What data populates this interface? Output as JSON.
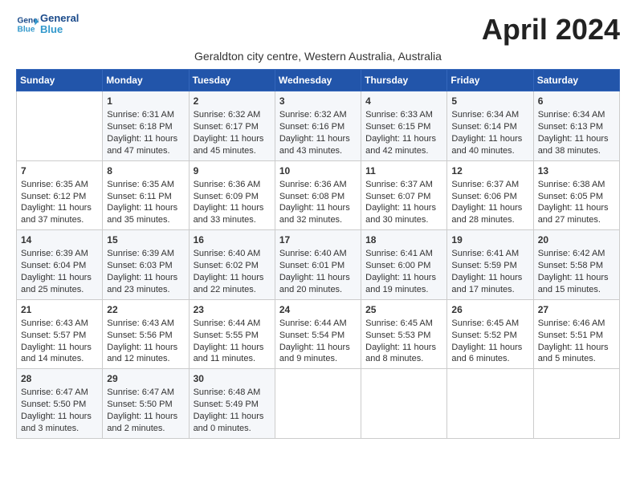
{
  "header": {
    "logo_line1": "General",
    "logo_line2": "Blue",
    "month_title": "April 2024",
    "subtitle": "Geraldton city centre, Western Australia, Australia"
  },
  "days_of_week": [
    "Sunday",
    "Monday",
    "Tuesday",
    "Wednesday",
    "Thursday",
    "Friday",
    "Saturday"
  ],
  "weeks": [
    [
      {
        "day": "",
        "content": ""
      },
      {
        "day": "1",
        "content": "Sunrise: 6:31 AM\nSunset: 6:18 PM\nDaylight: 11 hours\nand 47 minutes."
      },
      {
        "day": "2",
        "content": "Sunrise: 6:32 AM\nSunset: 6:17 PM\nDaylight: 11 hours\nand 45 minutes."
      },
      {
        "day": "3",
        "content": "Sunrise: 6:32 AM\nSunset: 6:16 PM\nDaylight: 11 hours\nand 43 minutes."
      },
      {
        "day": "4",
        "content": "Sunrise: 6:33 AM\nSunset: 6:15 PM\nDaylight: 11 hours\nand 42 minutes."
      },
      {
        "day": "5",
        "content": "Sunrise: 6:34 AM\nSunset: 6:14 PM\nDaylight: 11 hours\nand 40 minutes."
      },
      {
        "day": "6",
        "content": "Sunrise: 6:34 AM\nSunset: 6:13 PM\nDaylight: 11 hours\nand 38 minutes."
      }
    ],
    [
      {
        "day": "7",
        "content": "Sunrise: 6:35 AM\nSunset: 6:12 PM\nDaylight: 11 hours\nand 37 minutes."
      },
      {
        "day": "8",
        "content": "Sunrise: 6:35 AM\nSunset: 6:11 PM\nDaylight: 11 hours\nand 35 minutes."
      },
      {
        "day": "9",
        "content": "Sunrise: 6:36 AM\nSunset: 6:09 PM\nDaylight: 11 hours\nand 33 minutes."
      },
      {
        "day": "10",
        "content": "Sunrise: 6:36 AM\nSunset: 6:08 PM\nDaylight: 11 hours\nand 32 minutes."
      },
      {
        "day": "11",
        "content": "Sunrise: 6:37 AM\nSunset: 6:07 PM\nDaylight: 11 hours\nand 30 minutes."
      },
      {
        "day": "12",
        "content": "Sunrise: 6:37 AM\nSunset: 6:06 PM\nDaylight: 11 hours\nand 28 minutes."
      },
      {
        "day": "13",
        "content": "Sunrise: 6:38 AM\nSunset: 6:05 PM\nDaylight: 11 hours\nand 27 minutes."
      }
    ],
    [
      {
        "day": "14",
        "content": "Sunrise: 6:39 AM\nSunset: 6:04 PM\nDaylight: 11 hours\nand 25 minutes."
      },
      {
        "day": "15",
        "content": "Sunrise: 6:39 AM\nSunset: 6:03 PM\nDaylight: 11 hours\nand 23 minutes."
      },
      {
        "day": "16",
        "content": "Sunrise: 6:40 AM\nSunset: 6:02 PM\nDaylight: 11 hours\nand 22 minutes."
      },
      {
        "day": "17",
        "content": "Sunrise: 6:40 AM\nSunset: 6:01 PM\nDaylight: 11 hours\nand 20 minutes."
      },
      {
        "day": "18",
        "content": "Sunrise: 6:41 AM\nSunset: 6:00 PM\nDaylight: 11 hours\nand 19 minutes."
      },
      {
        "day": "19",
        "content": "Sunrise: 6:41 AM\nSunset: 5:59 PM\nDaylight: 11 hours\nand 17 minutes."
      },
      {
        "day": "20",
        "content": "Sunrise: 6:42 AM\nSunset: 5:58 PM\nDaylight: 11 hours\nand 15 minutes."
      }
    ],
    [
      {
        "day": "21",
        "content": "Sunrise: 6:43 AM\nSunset: 5:57 PM\nDaylight: 11 hours\nand 14 minutes."
      },
      {
        "day": "22",
        "content": "Sunrise: 6:43 AM\nSunset: 5:56 PM\nDaylight: 11 hours\nand 12 minutes."
      },
      {
        "day": "23",
        "content": "Sunrise: 6:44 AM\nSunset: 5:55 PM\nDaylight: 11 hours\nand 11 minutes."
      },
      {
        "day": "24",
        "content": "Sunrise: 6:44 AM\nSunset: 5:54 PM\nDaylight: 11 hours\nand 9 minutes."
      },
      {
        "day": "25",
        "content": "Sunrise: 6:45 AM\nSunset: 5:53 PM\nDaylight: 11 hours\nand 8 minutes."
      },
      {
        "day": "26",
        "content": "Sunrise: 6:45 AM\nSunset: 5:52 PM\nDaylight: 11 hours\nand 6 minutes."
      },
      {
        "day": "27",
        "content": "Sunrise: 6:46 AM\nSunset: 5:51 PM\nDaylight: 11 hours\nand 5 minutes."
      }
    ],
    [
      {
        "day": "28",
        "content": "Sunrise: 6:47 AM\nSunset: 5:50 PM\nDaylight: 11 hours\nand 3 minutes."
      },
      {
        "day": "29",
        "content": "Sunrise: 6:47 AM\nSunset: 5:50 PM\nDaylight: 11 hours\nand 2 minutes."
      },
      {
        "day": "30",
        "content": "Sunrise: 6:48 AM\nSunset: 5:49 PM\nDaylight: 11 hours\nand 0 minutes."
      },
      {
        "day": "",
        "content": ""
      },
      {
        "day": "",
        "content": ""
      },
      {
        "day": "",
        "content": ""
      },
      {
        "day": "",
        "content": ""
      }
    ]
  ]
}
